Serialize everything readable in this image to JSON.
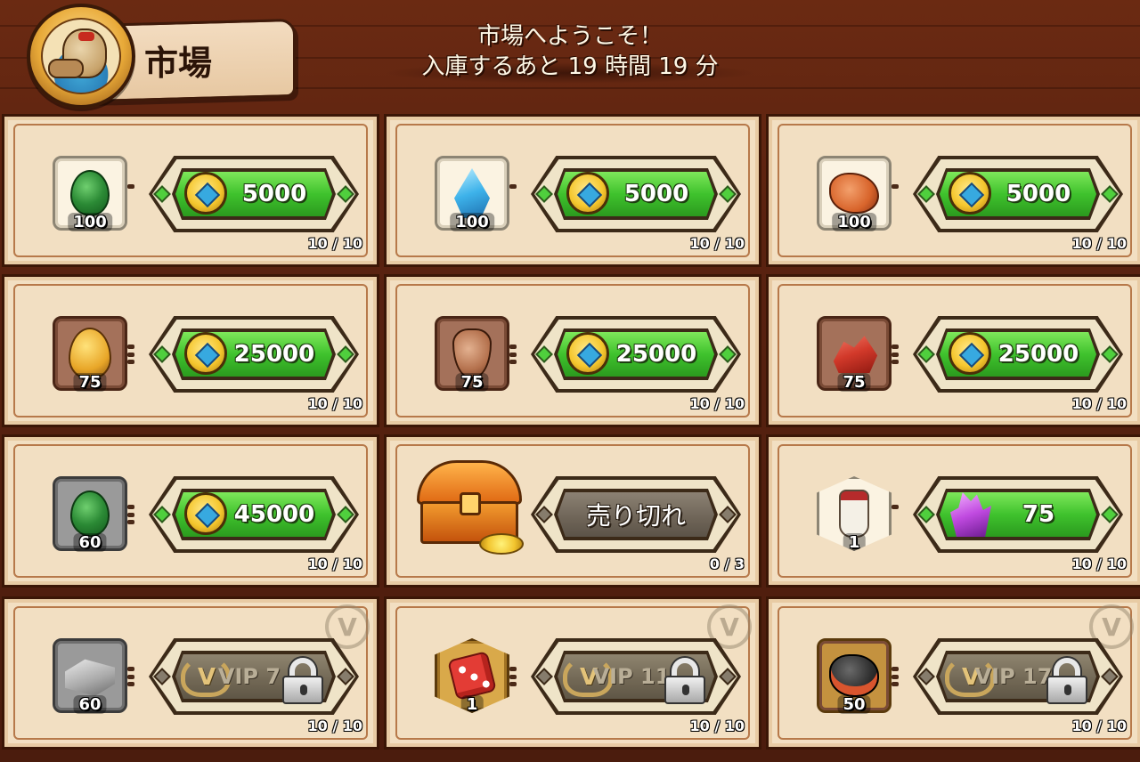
{
  "header": {
    "title": "市場",
    "welcome_line1": "市場へようこそ！",
    "welcome_line2": "入庫するあと 19 時間 19 分"
  },
  "colors": {
    "buy_green": "#3fc22d",
    "wood": "#5a2210",
    "parchment": "#f2dfc2"
  },
  "items": [
    {
      "icon": "green-gem-icon",
      "qty": "100",
      "price": "5000",
      "currency": "gold-coin-icon",
      "stock": "10 / 10",
      "state": "available"
    },
    {
      "icon": "blue-crystal-icon",
      "qty": "100",
      "price": "5000",
      "currency": "gold-coin-icon",
      "stock": "10 / 10",
      "state": "available"
    },
    {
      "icon": "orange-ore-icon",
      "qty": "100",
      "price": "5000",
      "currency": "gold-coin-icon",
      "stock": "10 / 10",
      "state": "available"
    },
    {
      "icon": "golden-egg-icon",
      "qty": "75",
      "price": "25000",
      "currency": "gold-coin-icon",
      "stock": "10 / 10",
      "state": "available"
    },
    {
      "icon": "clay-vase-icon",
      "qty": "75",
      "price": "25000",
      "currency": "gold-coin-icon",
      "stock": "10 / 10",
      "state": "available"
    },
    {
      "icon": "red-ore-icon",
      "qty": "75",
      "price": "25000",
      "currency": "gold-coin-icon",
      "stock": "10 / 10",
      "state": "available"
    },
    {
      "icon": "green-gem-icon",
      "qty": "60",
      "price": "45000",
      "currency": "gold-coin-icon",
      "stock": "10 / 10",
      "state": "available"
    },
    {
      "icon": "treasure-chest-icon",
      "qty": "",
      "price": "売り切れ",
      "currency": "",
      "stock": "0 / 3",
      "state": "sold-out"
    },
    {
      "icon": "white-tassel-icon",
      "qty": "1",
      "price": "75",
      "currency": "purple-crystal-icon",
      "stock": "10 / 10",
      "state": "available"
    },
    {
      "icon": "silver-bars-icon",
      "qty": "60",
      "price": "VIP 7",
      "currency": "vip-laurel-icon",
      "stock": "10 / 10",
      "state": "locked"
    },
    {
      "icon": "red-dice-icon",
      "qty": "1",
      "price": "VIP 11",
      "currency": "vip-laurel-icon",
      "stock": "10 / 10",
      "state": "locked"
    },
    {
      "icon": "coal-ore-icon",
      "qty": "50",
      "price": "VIP 17",
      "currency": "vip-laurel-icon",
      "stock": "10 / 10",
      "state": "locked"
    }
  ]
}
